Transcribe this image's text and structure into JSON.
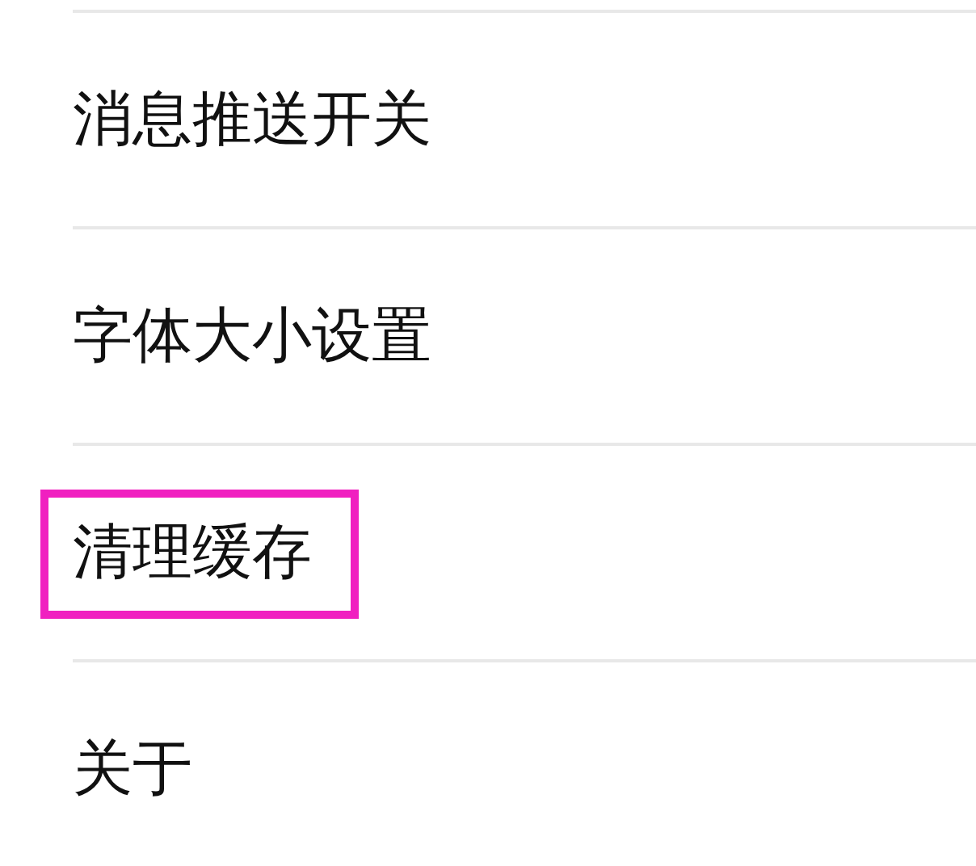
{
  "settings_items": [
    {
      "label": "消息推送开关",
      "highlighted": false
    },
    {
      "label": "字体大小设置",
      "highlighted": false
    },
    {
      "label": "清理缓存",
      "highlighted": true
    },
    {
      "label": "关于",
      "highlighted": false
    }
  ]
}
